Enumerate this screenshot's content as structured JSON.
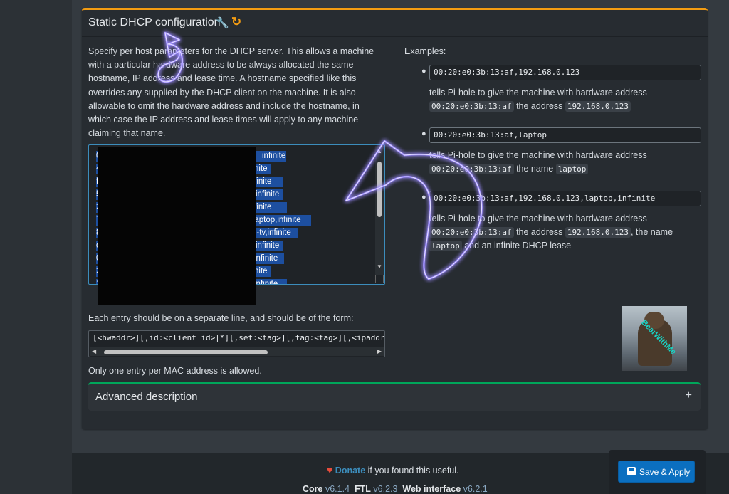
{
  "panel": {
    "title": "Static DHCP configuration",
    "wrench_icon": "wrench-icon",
    "refresh_icon": "refresh-icon",
    "description": "Specify per host parameters for the DHCP server. This allows a machine with a particular hardware address to be always allocated the same hostname, IP address and lease time. A hostname specified like this overrides any supplied by the DHCP client on the machine. It is also allowable to omit the hardware address and include the hostname, in which case the IP address and lease times will apply to any machine claiming that name.",
    "hosts_visible_endings": [
      "infinite",
      "nite",
      ",infinite",
      "infinite",
      ",infinite",
      "-laptop,infinite",
      "n-tv,infinite",
      "infinite",
      "infinite",
      "nite",
      "infinite"
    ],
    "hosts_leading_chars": [
      "0",
      "4",
      "f",
      "5",
      "2",
      "7",
      "8",
      "c",
      "0",
      "2",
      "1"
    ],
    "form_label": "Each entry should be on a separate line, and should be of the form:",
    "form_code": "[<hwaddr>][,id:<client_id>|*][,set:<tag>][,tag:<tag>][,<ipaddr>][,<hostname>][,<lease_time>][,ignore]",
    "only_one": "Only one entry per MAC address is allowed.",
    "examples_label": "Examples:",
    "examples": [
      {
        "input": "00:20:e0:3b:13:af,192.168.0.123",
        "text_1": "tells Pi-hole to give the machine with hardware address",
        "code_1": "00:20:e0:3b:13:af",
        "text_2": "the address",
        "code_2": "192.168.0.123"
      },
      {
        "input": "00:20:e0:3b:13:af,laptop",
        "text_1": "tells Pi-hole to give the machine with hardware address",
        "code_1": "00:20:e0:3b:13:af",
        "text_2": "the name",
        "code_2": "laptop"
      },
      {
        "input": "00:20:e0:3b:13:af,192.168.0.123,laptop,infinite",
        "text_1": "tells Pi-hole to give the machine with hardware address",
        "code_1": "00:20:e0:3b:13:af",
        "text_2": "the address",
        "code_2": "192.168.0.123",
        "text_3": ", the name",
        "code_3": "laptop",
        "text_4": "and an infinite DHCP lease"
      }
    ],
    "advanced_title": "Advanced description",
    "advanced_toggle": "+",
    "thumbnail_text": "BearWithMe",
    "advanced_accent": "#00a65a",
    "header_accent": "#f39c12"
  },
  "footer": {
    "heart_icon": "heart-icon",
    "donate_link": "Donate",
    "donate_text": "if you found this useful.",
    "core_label": "Core",
    "core_version": "v6.1.4",
    "ftl_label": "FTL",
    "ftl_version": "v6.2.3",
    "web_label": "Web interface",
    "web_version": "v6.2.1"
  },
  "save_button": {
    "label": "Save & Apply",
    "icon": "save-icon",
    "color": "#0b6fc0"
  }
}
